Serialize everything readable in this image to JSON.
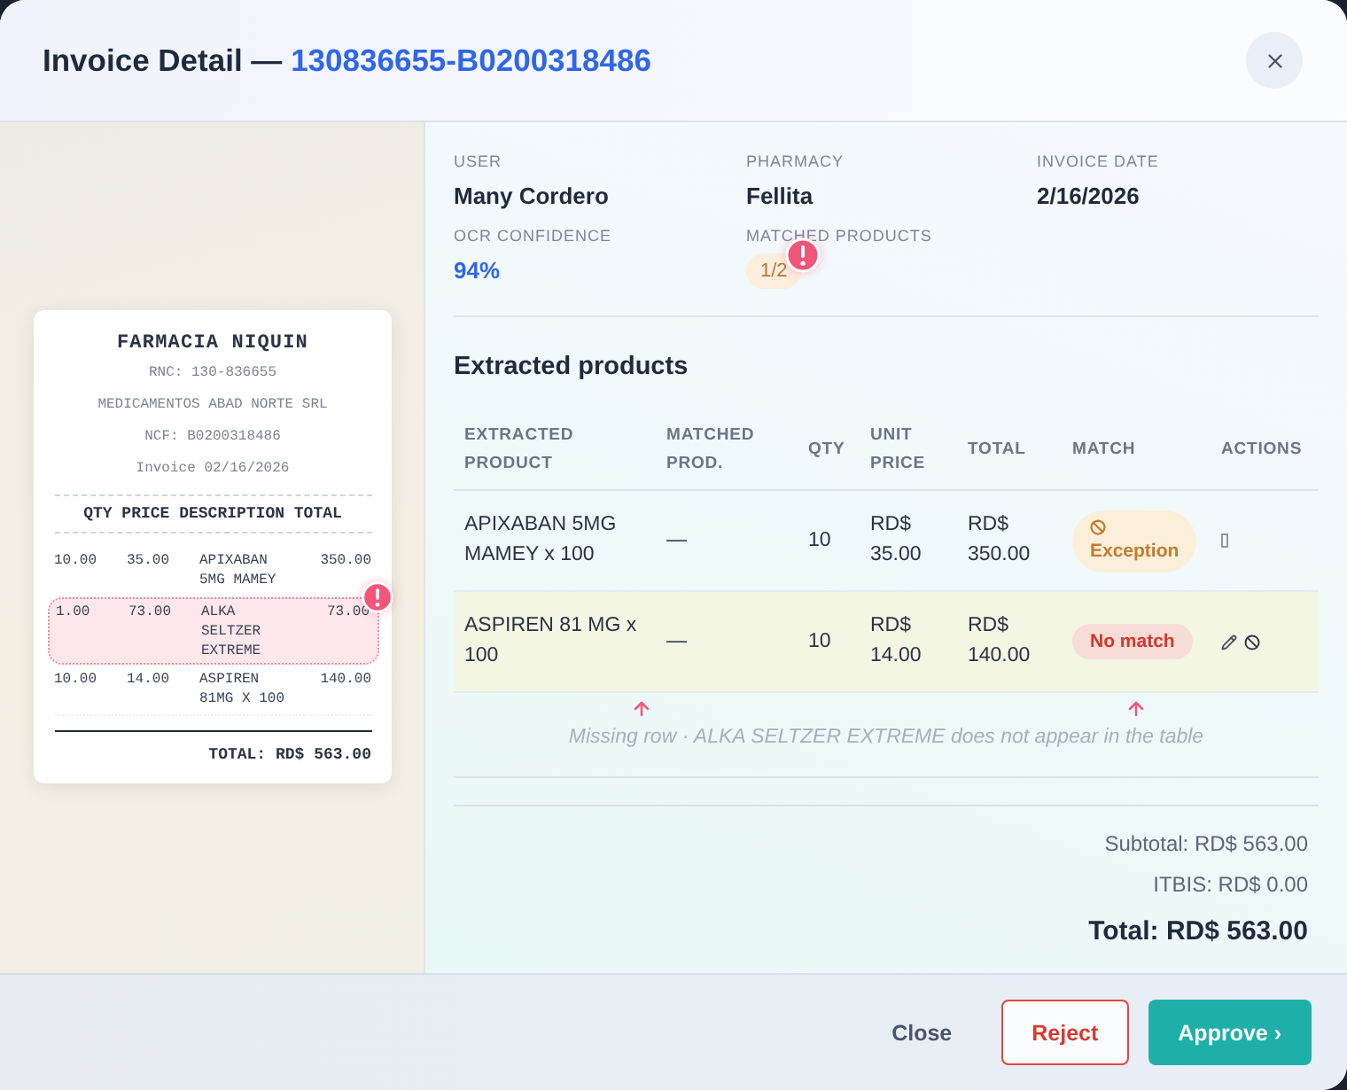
{
  "dialog": {
    "title": "Invoice Detail —",
    "invoice_id": "130836655-B0200318486"
  },
  "receipt": {
    "store": "FARMACIA NIQUIN",
    "lines": [
      "RNC: 130-836655",
      "MEDICAMENTOS ABAD NORTE SRL",
      "NCF: B0200318486",
      "Invoice 02/16/2026"
    ],
    "header": "QTY PRICE DESCRIPTION TOTAL",
    "rows": [
      {
        "qty": "10.00",
        "price": "35.00",
        "description": "APIXABAN 5MG MAMEY",
        "total": "350.00",
        "flagged": false
      },
      {
        "qty": "1.00",
        "price": "73.00",
        "description": "ALKA SELTZER EXTREME",
        "total": "73.00",
        "flagged": true
      },
      {
        "qty": "10.00",
        "price": "14.00",
        "description": "ASPIREN 81MG X 100",
        "total": "140.00",
        "flagged": false
      }
    ],
    "total": "TOTAL: RD$ 563.00"
  },
  "details": [
    {
      "label": "USER",
      "value": "Many Cordero",
      "kind": "text"
    },
    {
      "label": "PHARMACY",
      "value": "Fellita",
      "kind": "text"
    },
    {
      "label": "INVOICE DATE",
      "value": "2/16/2026",
      "kind": "text"
    },
    {
      "label": "OCR CONFIDENCE",
      "value": "94%",
      "kind": "accent"
    }
  ],
  "matched_products": {
    "label": "MATCHED PRODUCTS",
    "value": "1/2",
    "flagged": true
  },
  "products": {
    "title": "Extracted products",
    "columns": [
      "EXTRACTED PRODUCT",
      "MATCHED PROD.",
      "QTY",
      "UNIT PRICE",
      "TOTAL",
      "MATCH",
      "ACTIONS"
    ],
    "rows": [
      {
        "extracted": "APIXABAN 5MG MAMEY x 100",
        "matched": "—",
        "qty": "10",
        "unit_price": "RD$ 35.00",
        "total": "RD$ 350.00",
        "match": {
          "kind": "exception",
          "label": "Exception"
        },
        "actions": [
          {
            "kind": "unknown"
          }
        ],
        "highlighted": false
      },
      {
        "extracted": "ASPIREN 81 MG x 100",
        "matched": "—",
        "qty": "10",
        "unit_price": "RD$ 14.00",
        "total": "RD$ 140.00",
        "match": {
          "kind": "no_match",
          "label": "No match"
        },
        "actions": [
          {
            "kind": "edit"
          },
          {
            "kind": "ban"
          }
        ],
        "highlighted": true
      }
    ],
    "missing_note": "Missing row · ALKA SELTZER EXTREME does not appear in the table"
  },
  "totals": [
    {
      "label": "Subtotal: RD$ 563.00",
      "kind": "line"
    },
    {
      "label": "ITBIS: RD$ 0.00",
      "kind": "line"
    },
    {
      "label": "Total: RD$ 563.00",
      "kind": "grand"
    }
  ],
  "buttons": [
    {
      "label": "Close",
      "kind": "plain"
    },
    {
      "label": "Reject",
      "kind": "danger"
    },
    {
      "label": "Approve ›",
      "kind": "primary"
    }
  ]
}
